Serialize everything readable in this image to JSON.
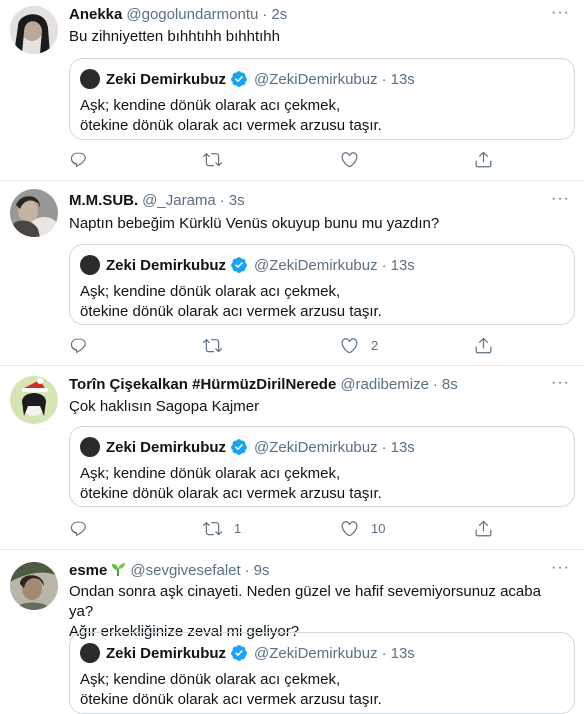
{
  "quote": {
    "name": "Zeki Demirkubuz",
    "handle": "@ZekiDemirkubuz",
    "time": "13s",
    "line1": "Aşk; kendine dönük olarak acı çekmek,",
    "line2": "ötekine dönük olarak acı vermek arzusu taşır."
  },
  "tweets": [
    {
      "name": "Anekka",
      "handle": "@gogolundarmontu",
      "time": "2s",
      "text": "Bu zihniyetten bıhhtıhh bıhhtıhh",
      "text2": "",
      "retweets": "",
      "likes": ""
    },
    {
      "name": "M.M.SUB.",
      "handle": "@_Jarama",
      "time": "3s",
      "text": "Naptın bebeğim Kürklü Venüs okuyup bunu mu yazdın?",
      "text2": "",
      "retweets": "",
      "likes": "2"
    },
    {
      "name": "Torîn Çişekalkan #HürmüzDirilNerede",
      "handle": "@radibemize",
      "time": "8s",
      "text": "Çok haklısın Sagopa Kajmer",
      "text2": "",
      "retweets": "1",
      "likes": "10"
    },
    {
      "name": "esme",
      "handle": "@sevgivesefalet",
      "time": "9s",
      "text": "Ondan sonra aşk cinayeti. Neden güzel ve hafif sevemiyorsunuz acaba ya?",
      "text2": "Ağır erkekliğinize zeval mi geliyor?",
      "retweets": "",
      "likes": ""
    }
  ],
  "more_label": "···",
  "icons": {
    "reply": "reply-icon",
    "retweet": "retweet-icon",
    "like": "heart-icon",
    "share": "share-icon",
    "verified": "verified-badge-icon",
    "sprout": "sprout-emoji-icon"
  },
  "colors": {
    "secondary_text": "#5b7083",
    "verified": "#1da1f2",
    "border": "#cfd9de"
  }
}
